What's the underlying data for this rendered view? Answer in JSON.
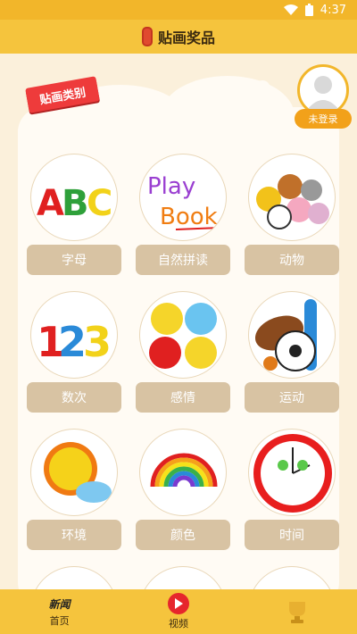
{
  "status": {
    "time": "4:37"
  },
  "header": {
    "title": "贴画奖品"
  },
  "ribbon": "贴画类别",
  "user": {
    "login_label": "未登录"
  },
  "categories": [
    {
      "name": "字母",
      "icon": "abc-letters-icon"
    },
    {
      "name": "自然拼读",
      "icon": "play-book-icon",
      "art": [
        "Play",
        "Book"
      ]
    },
    {
      "name": "动物",
      "icon": "animals-icon"
    },
    {
      "name": "数次",
      "icon": "numbers-123-icon"
    },
    {
      "name": "感情",
      "icon": "emotions-icon"
    },
    {
      "name": "运动",
      "icon": "sports-balls-icon"
    },
    {
      "name": "环境",
      "icon": "sun-cloud-icon"
    },
    {
      "name": "颜色",
      "icon": "rainbow-icon"
    },
    {
      "name": "时间",
      "icon": "clock-icon"
    }
  ],
  "nav": {
    "home_top": "新闻",
    "home": "首页",
    "video": "视频"
  },
  "colors": {
    "accent": "#f5c43d",
    "label_bg": "#d8c3a3",
    "ribbon": "#ee3b3b"
  }
}
